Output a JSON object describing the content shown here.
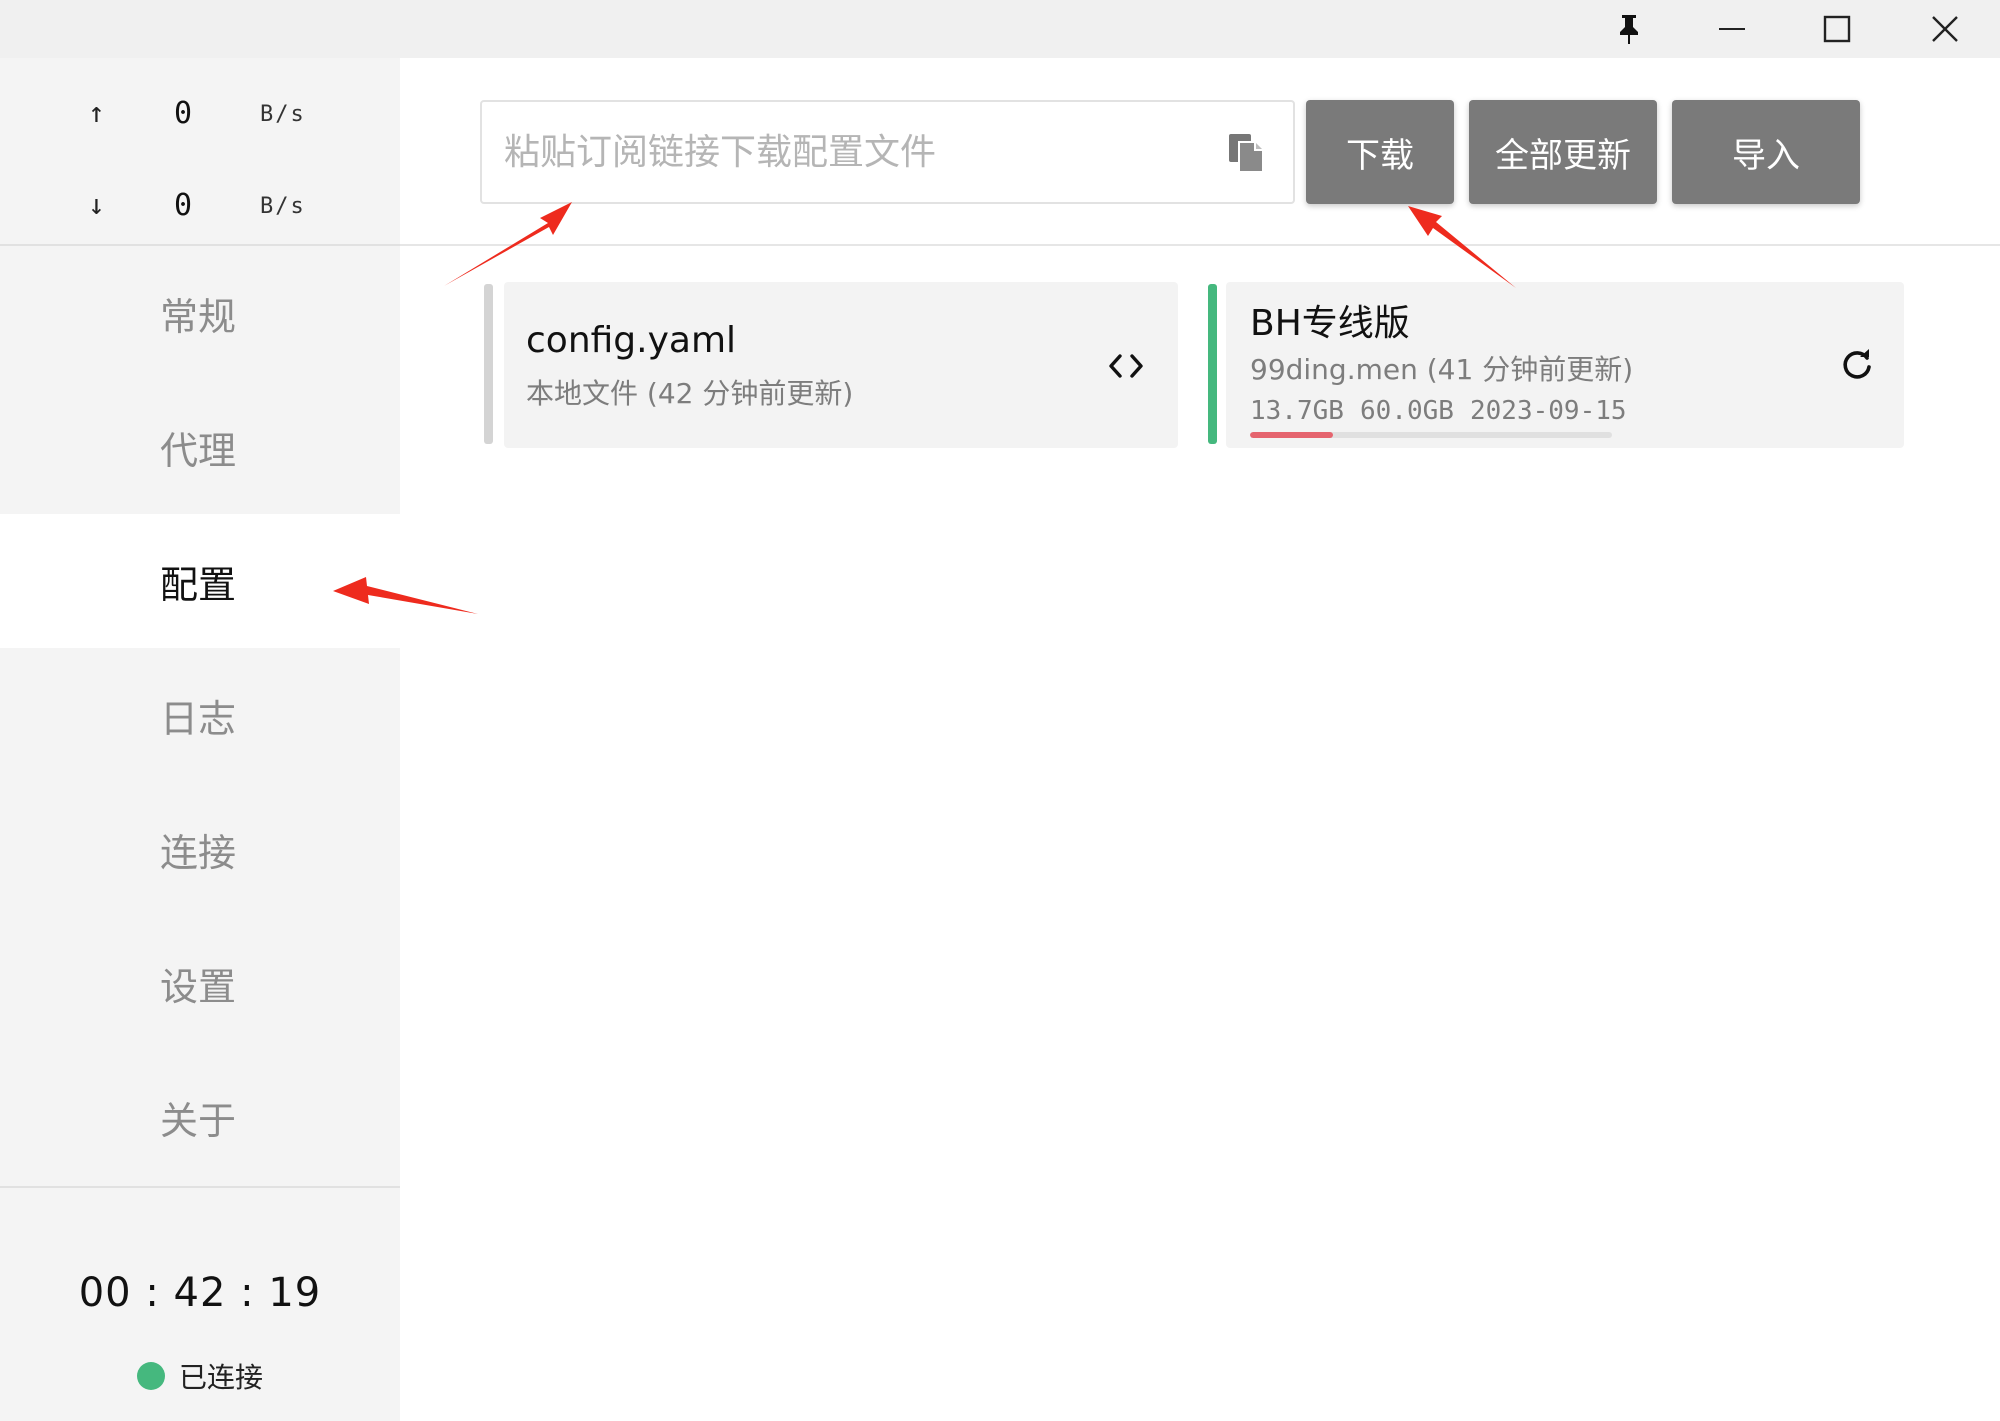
{
  "traffic": {
    "up": {
      "arrow": "↑",
      "value": "0",
      "unit": "B/s"
    },
    "down": {
      "arrow": "↓",
      "value": "0",
      "unit": "B/s"
    }
  },
  "nav": [
    {
      "label": "常规"
    },
    {
      "label": "代理"
    },
    {
      "label": "配置",
      "active": true
    },
    {
      "label": "日志"
    },
    {
      "label": "连接"
    },
    {
      "label": "设置"
    },
    {
      "label": "关于"
    }
  ],
  "status": {
    "timer": "00 : 42 : 19",
    "label": "已连接",
    "color": "#45b87e"
  },
  "toolbar": {
    "url_placeholder": "粘贴订阅链接下载配置文件",
    "url_value": "",
    "download_label": "下载",
    "update_all_label": "全部更新",
    "import_label": "导入"
  },
  "profiles": [
    {
      "name": "config.yaml",
      "subtitle": "本地文件 (42 分钟前更新)",
      "bar_color": "#d4d4d4"
    },
    {
      "name": "BH专线版",
      "subtitle": "99ding.men (41 分钟前更新)",
      "used": "13.7GB",
      "total": "60.0GB",
      "expire": "2023-09-15",
      "usage_fraction": 0.228,
      "bar_color": "#45b87e",
      "usage_color": "#e5646e"
    }
  ],
  "colors": {
    "button_bg": "#7a7a7a",
    "sidebar_bg": "#f4f4f4",
    "annotation": "#ee2b1e"
  }
}
